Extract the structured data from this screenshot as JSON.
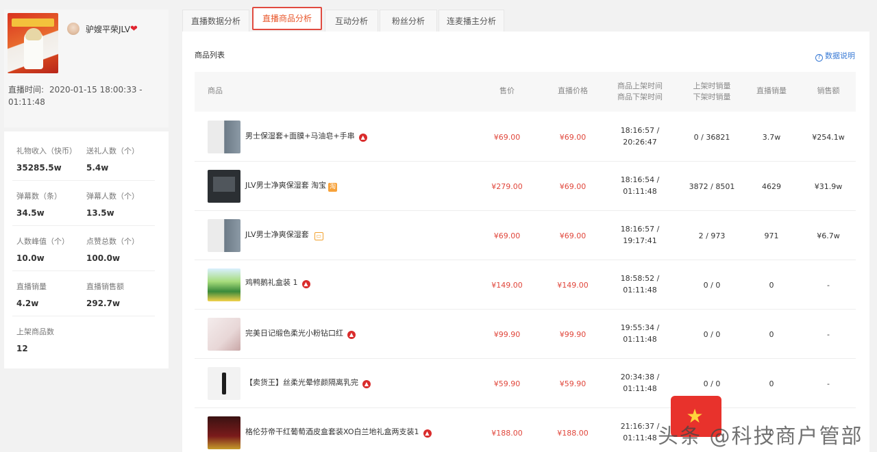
{
  "anchor": {
    "name": "驴嫂平荣JLV",
    "live_time_label": "直播时间:",
    "live_time_value": "2020-01-15 18:00:33 - 01:11:48"
  },
  "stats": [
    {
      "label": "礼物收入（快币）",
      "value": "35285.5w"
    },
    {
      "label": "送礼人数（个）",
      "value": "5.4w"
    },
    {
      "label": "弹幕数（条）",
      "value": "34.5w"
    },
    {
      "label": "弹幕人数（个）",
      "value": "13.5w"
    },
    {
      "label": "人数峰值（个）",
      "value": "10.0w"
    },
    {
      "label": "点赞总数（个）",
      "value": "100.0w"
    },
    {
      "label": "直播销量",
      "value": "4.2w"
    },
    {
      "label": "直播销售额",
      "value": "292.7w"
    },
    {
      "label": "上架商品数",
      "value": "12"
    }
  ],
  "tabs": [
    {
      "label": "直播数据分析",
      "active": false
    },
    {
      "label": "直播商品分析",
      "active": true
    },
    {
      "label": "互动分析",
      "active": false
    },
    {
      "label": "粉丝分析",
      "active": false
    },
    {
      "label": "连麦播主分析",
      "active": false
    }
  ],
  "section_title": "商品列表",
  "data_help": "数据说明",
  "columns": {
    "product": "商品",
    "price": "售价",
    "live_price": "直播价格",
    "time_1": "商品上架时间",
    "time_2": "商品下架时间",
    "sales_1": "上架时销量",
    "sales_2": "下架时销量",
    "live_sales": "直播销量",
    "revenue": "销售额"
  },
  "rows": [
    {
      "name": "男士保湿套+面膜+马油皂+手串",
      "badge": "fire",
      "price": "¥69.00",
      "live_price": "¥69.00",
      "time_on": "18:16:57 /",
      "time_off": "20:26:47",
      "sales": "0 / 36821",
      "live_sales": "3.7w",
      "revenue": "¥254.1w"
    },
    {
      "name": "JLV男士净爽保湿套 淘宝",
      "badge": "taobao",
      "price": "¥279.00",
      "live_price": "¥69.00",
      "time_on": "18:16:54 /",
      "time_off": "01:11:48",
      "sales": "3872 / 8501",
      "live_sales": "4629",
      "revenue": "¥31.9w"
    },
    {
      "name": "JLV男士净爽保湿套",
      "badge": "store",
      "price": "¥69.00",
      "live_price": "¥69.00",
      "time_on": "18:16:57 /",
      "time_off": "19:17:41",
      "sales": "2 / 973",
      "live_sales": "971",
      "revenue": "¥6.7w"
    },
    {
      "name": "鸡鸭鹅礼盒装 1",
      "badge": "fire",
      "price": "¥149.00",
      "live_price": "¥149.00",
      "time_on": "18:58:52 /",
      "time_off": "01:11:48",
      "sales": "0 / 0",
      "live_sales": "0",
      "revenue": "-"
    },
    {
      "name": "完美日记缎色柔光小粉钻口红",
      "badge": "fire",
      "price": "¥99.90",
      "live_price": "¥99.90",
      "time_on": "19:55:34 /",
      "time_off": "01:11:48",
      "sales": "0 / 0",
      "live_sales": "0",
      "revenue": "-"
    },
    {
      "name": "【卖货王】丝柔光晕修颜隔离乳完",
      "badge": "fire",
      "price": "¥59.90",
      "live_price": "¥59.90",
      "time_on": "20:34:38 /",
      "time_off": "01:11:48",
      "sales": "0 / 0",
      "live_sales": "0",
      "revenue": "-"
    },
    {
      "name": "格伦芬帝干红葡萄酒皮盒套装XO白兰地礼盒两支装1",
      "badge": "fire",
      "price": "¥188.00",
      "live_price": "¥188.00",
      "time_on": "21:16:37 /",
      "time_off": "01:11:48",
      "sales": "0 / 0",
      "live_sales": "0",
      "revenue": "-"
    }
  ],
  "watermark": {
    "text": "头条 @科技商户管部"
  },
  "colors": {
    "accent": "#e8562a",
    "price_red": "#e0453a",
    "link_blue": "#3a7bd5"
  }
}
